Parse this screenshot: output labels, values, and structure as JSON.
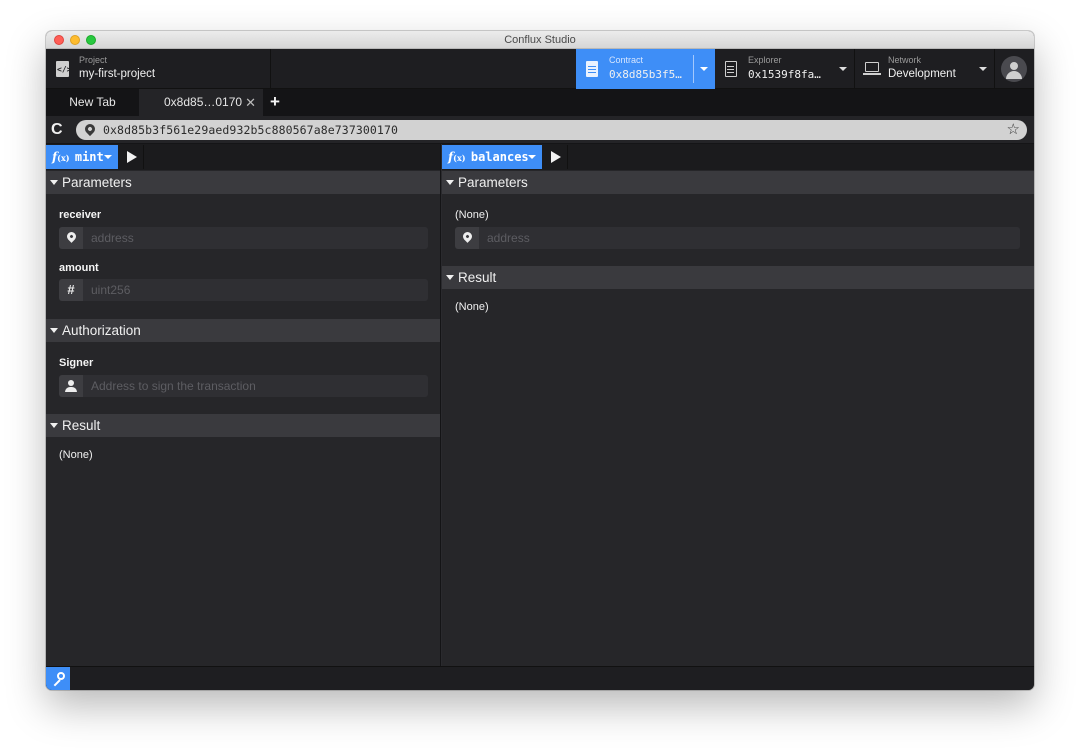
{
  "window": {
    "title": "Conflux Studio"
  },
  "navbar": {
    "project": {
      "label": "Project",
      "value": "my-first-project"
    },
    "contract": {
      "label": "Contract",
      "value": "0x8d85b3f5…"
    },
    "explorer": {
      "label": "Explorer",
      "value": "0x1539f8fa…"
    },
    "network": {
      "label": "Network",
      "value": "Development"
    }
  },
  "tabs": [
    {
      "label": "New Tab",
      "active": false
    },
    {
      "label": "0x8d85…0170",
      "active": true,
      "close": "✕"
    }
  ],
  "tab_add": "+",
  "address": {
    "reload": "C",
    "value": "0x8d85b3f561e29aed932b5c880567a8e737300170",
    "star": "☆"
  },
  "left_pane": {
    "function": {
      "prefix": "f",
      "suffix": "(x)",
      "name": "mint"
    },
    "parameters_title": "Parameters",
    "params": [
      {
        "label": "receiver",
        "placeholder": "address",
        "icon": "pin-icon"
      },
      {
        "label": "amount",
        "placeholder": "uint256",
        "icon": "hash-icon"
      }
    ],
    "authorization_title": "Authorization",
    "signer": {
      "label": "Signer",
      "placeholder": "Address to sign the transaction"
    },
    "result_title": "Result",
    "result_value": "(None)"
  },
  "right_pane": {
    "function": {
      "prefix": "f",
      "suffix": "(x)",
      "name": "balances"
    },
    "parameters_title": "Parameters",
    "param_label": "(None)",
    "param_placeholder": "address",
    "result_title": "Result",
    "result_value": "(None)"
  },
  "colors": {
    "accent": "#3e8ef7",
    "background": "#262629",
    "section_header": "#3a3a3e"
  }
}
